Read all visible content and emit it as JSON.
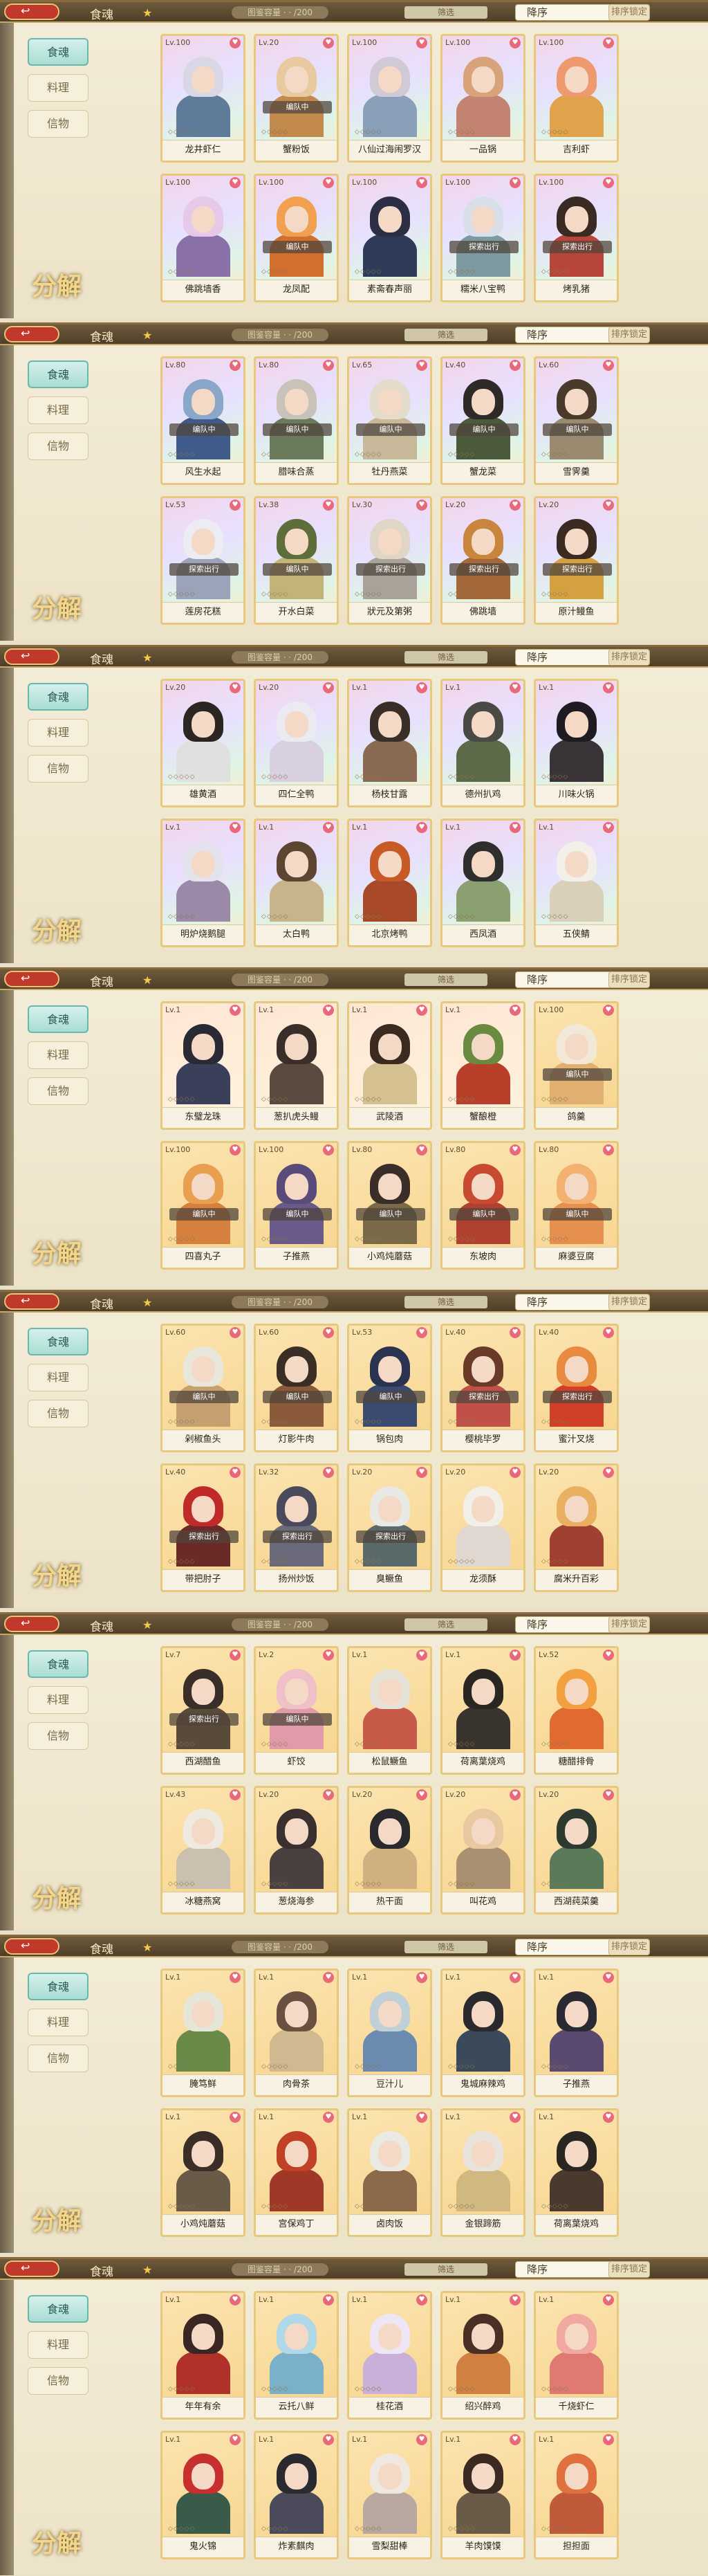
{
  "app": {
    "back_label": "↩",
    "title": "食魂",
    "capacity_text": "图鉴容量 · · /200",
    "filter_label": "筛选",
    "sort_label": "降序",
    "sort_lock_label": "排序锁定",
    "tabs": [
      "食魂",
      "料理",
      "信物"
    ],
    "decompose_label": "分解"
  },
  "status_labels": {
    "team": "编队中",
    "explore": "探索出行"
  },
  "icons": {
    "back": "back-arrow-icon",
    "heart": "heart-icon",
    "star": "star-icon"
  },
  "panels": [
    {
      "cards": [
        {
          "lv": "Lv.100",
          "name": "龙井虾仁",
          "status": "",
          "rarity": "ssr",
          "hair": "#d9d7e6",
          "outfit": "#5e7b9a"
        },
        {
          "lv": "Lv.20",
          "name": "蟹粉饭",
          "status": "team",
          "rarity": "ssr",
          "hair": "#e8c9a0",
          "outfit": "#c28a4c"
        },
        {
          "lv": "Lv.100",
          "name": "八仙过海闹罗汉",
          "status": "",
          "rarity": "ssr",
          "hair": "#cfcad6",
          "outfit": "#8aa0b8"
        },
        {
          "lv": "Lv.100",
          "name": "一品锅",
          "status": "",
          "rarity": "ssr",
          "hair": "#d9a37a",
          "outfit": "#c28470"
        },
        {
          "lv": "Lv.100",
          "name": "吉利虾",
          "status": "",
          "rarity": "ssr",
          "hair": "#ef9a6e",
          "outfit": "#e0a24a"
        },
        {
          "lv": "Lv.100",
          "name": "佛跳墙香",
          "status": "",
          "rarity": "ssr",
          "hair": "#e6c8e8",
          "outfit": "#8a70a8"
        },
        {
          "lv": "Lv.100",
          "name": "龙凤配",
          "status": "team",
          "rarity": "ssr",
          "hair": "#f1a050",
          "outfit": "#d36f2e"
        },
        {
          "lv": "Lv.100",
          "name": "素斋春声丽",
          "status": "",
          "rarity": "ssr",
          "hair": "#2c2f44",
          "outfit": "#2e3b58"
        },
        {
          "lv": "Lv.100",
          "name": "糯米八宝鸭",
          "status": "explore",
          "rarity": "ssr",
          "hair": "#d9dfe8",
          "outfit": "#7d9aa0"
        },
        {
          "lv": "Lv.100",
          "name": "烤乳猪",
          "status": "explore",
          "rarity": "ssr",
          "hair": "#3a2a24",
          "outfit": "#b8453a"
        }
      ]
    },
    {
      "cards": [
        {
          "lv": "Lv.80",
          "name": "风生水起",
          "status": "team",
          "rarity": "ssr",
          "hair": "#8aa6c8",
          "outfit": "#3f5b8a"
        },
        {
          "lv": "Lv.80",
          "name": "腊味合蒸",
          "status": "team",
          "rarity": "ssr",
          "hair": "#c9c2b8",
          "outfit": "#6a7a5c"
        },
        {
          "lv": "Lv.65",
          "name": "牡丹燕菜",
          "status": "team",
          "rarity": "ssr",
          "hair": "#e4dccb",
          "outfit": "#c8b89a"
        },
        {
          "lv": "Lv.40",
          "name": "蟹龙菜",
          "status": "team",
          "rarity": "ssr",
          "hair": "#2e2a28",
          "outfit": "#4a5a3a"
        },
        {
          "lv": "Lv.60",
          "name": "雪霁羹",
          "status": "team",
          "rarity": "ssr",
          "hair": "#4a3a2c",
          "outfit": "#9a8a70"
        },
        {
          "lv": "Lv.53",
          "name": "莲房花糕",
          "status": "explore",
          "rarity": "ssr",
          "hair": "#ececf2",
          "outfit": "#9aa3ba"
        },
        {
          "lv": "Lv.38",
          "name": "开水白菜",
          "status": "team",
          "rarity": "ssr",
          "hair": "#5e6e3a",
          "outfit": "#c2b478"
        },
        {
          "lv": "Lv.30",
          "name": "狀元及第粥",
          "status": "explore",
          "rarity": "ssr",
          "hair": "#e0d6c8",
          "outfit": "#a8a298"
        },
        {
          "lv": "Lv.20",
          "name": "佛跳墙",
          "status": "explore",
          "rarity": "ssr",
          "hair": "#c9853c",
          "outfit": "#a4683a"
        },
        {
          "lv": "Lv.20",
          "name": "原汁鳗鱼",
          "status": "explore",
          "rarity": "ssr",
          "hair": "#3a2a20",
          "outfit": "#d4a040"
        }
      ]
    },
    {
      "cards": [
        {
          "lv": "Lv.20",
          "name": "雄黄酒",
          "status": "",
          "rarity": "ssr",
          "hair": "#2c2622",
          "outfit": "#e0e0e0"
        },
        {
          "lv": "Lv.20",
          "name": "四仁全鸭",
          "status": "",
          "rarity": "ssr",
          "hair": "#eaeaf0",
          "outfit": "#d8d0e0"
        },
        {
          "lv": "Lv.1",
          "name": "杨枝甘露",
          "status": "",
          "rarity": "ssr",
          "hair": "#3a2e28",
          "outfit": "#8a6a52"
        },
        {
          "lv": "Lv.1",
          "name": "德州扒鸡",
          "status": "",
          "rarity": "ssr",
          "hair": "#4a4a44",
          "outfit": "#5c6a4a"
        },
        {
          "lv": "Lv.1",
          "name": "川味火锅",
          "status": "",
          "rarity": "ssr",
          "hair": "#1e1c22",
          "outfit": "#3a3438"
        },
        {
          "lv": "Lv.1",
          "name": "明炉烧鹅腿",
          "status": "",
          "rarity": "ssr",
          "hair": "#e4e2ec",
          "outfit": "#9a8aa8"
        },
        {
          "lv": "Lv.1",
          "name": "太白鸭",
          "status": "",
          "rarity": "ssr",
          "hair": "#5c4632",
          "outfit": "#c8b48a"
        },
        {
          "lv": "Lv.1",
          "name": "北京烤鸭",
          "status": "",
          "rarity": "ssr",
          "hair": "#c85a28",
          "outfit": "#a84a2a"
        },
        {
          "lv": "Lv.1",
          "name": "西凤酒",
          "status": "",
          "rarity": "ssr",
          "hair": "#2e2e2c",
          "outfit": "#8aa070"
        },
        {
          "lv": "Lv.1",
          "name": "五侠鲭",
          "status": "",
          "rarity": "ssr",
          "hair": "#f2f0e8",
          "outfit": "#d8d0b8"
        }
      ]
    },
    {
      "cards": [
        {
          "lv": "Lv.1",
          "name": "东璧龙珠",
          "status": "",
          "rarity": "sr",
          "hair": "#2a2a34",
          "outfit": "#3a3f5a"
        },
        {
          "lv": "Lv.1",
          "name": "葱扒虎头鳗",
          "status": "",
          "rarity": "sr",
          "hair": "#3a2e2a",
          "outfit": "#5a4a40"
        },
        {
          "lv": "Lv.1",
          "name": "武陵酒",
          "status": "",
          "rarity": "sr",
          "hair": "#3a2a20",
          "outfit": "#d4c090"
        },
        {
          "lv": "Lv.1",
          "name": "蟹酿橙",
          "status": "",
          "rarity": "sr",
          "hair": "#6a8a40",
          "outfit": "#b8402a"
        },
        {
          "lv": "Lv.100",
          "name": "鸽羹",
          "status": "team",
          "rarity": "r",
          "hair": "#f2e8d8",
          "outfit": "#e0b070"
        },
        {
          "lv": "Lv.100",
          "name": "四喜丸子",
          "status": "team",
          "rarity": "r",
          "hair": "#e8a050",
          "outfit": "#d68040"
        },
        {
          "lv": "Lv.100",
          "name": "子推燕",
          "status": "team",
          "rarity": "r",
          "hair": "#5a4c7a",
          "outfit": "#6a5a8a"
        },
        {
          "lv": "Lv.80",
          "name": "小鸡炖蘑菇",
          "status": "team",
          "rarity": "r",
          "hair": "#3a2e28",
          "outfit": "#7a6a4a"
        },
        {
          "lv": "Lv.80",
          "name": "东坡肉",
          "status": "team",
          "rarity": "r",
          "hair": "#c84a30",
          "outfit": "#b04030"
        },
        {
          "lv": "Lv.80",
          "name": "麻婆豆腐",
          "status": "team",
          "rarity": "r",
          "hair": "#f4b070",
          "outfit": "#e69050"
        }
      ]
    },
    {
      "cards": [
        {
          "lv": "Lv.60",
          "name": "剁椒鱼头",
          "status": "team",
          "rarity": "r",
          "hair": "#e9e6dc",
          "outfit": "#c6a070"
        },
        {
          "lv": "Lv.60",
          "name": "灯影牛肉",
          "status": "team",
          "rarity": "r",
          "hair": "#3a2e26",
          "outfit": "#8a5a3a"
        },
        {
          "lv": "Lv.53",
          "name": "锅包肉",
          "status": "team",
          "rarity": "r",
          "hair": "#2a3450",
          "outfit": "#3a4a70"
        },
        {
          "lv": "Lv.40",
          "name": "樱桃毕罗",
          "status": "explore",
          "rarity": "r",
          "hair": "#6a3a28",
          "outfit": "#c05048"
        },
        {
          "lv": "Lv.40",
          "name": "蜜汁叉烧",
          "status": "explore",
          "rarity": "r",
          "hair": "#e88a40",
          "outfit": "#d04028"
        },
        {
          "lv": "Lv.40",
          "name": "带把肘子",
          "status": "explore",
          "rarity": "r",
          "hair": "#c02a28",
          "outfit": "#6a2a28"
        },
        {
          "lv": "Lv.32",
          "name": "扬州炒饭",
          "status": "explore",
          "rarity": "r",
          "hair": "#4a4a5c",
          "outfit": "#6a6a7a"
        },
        {
          "lv": "Lv.20",
          "name": "臭鳜鱼",
          "status": "explore",
          "rarity": "r",
          "hair": "#e8e8e4",
          "outfit": "#5a6a6a"
        },
        {
          "lv": "Lv.20",
          "name": "龙须酥",
          "status": "",
          "rarity": "r",
          "hair": "#f2eee8",
          "outfit": "#e0d8d0"
        },
        {
          "lv": "Lv.20",
          "name": "腐米升百彩",
          "status": "",
          "rarity": "r",
          "hair": "#e8b060",
          "outfit": "#a04030"
        }
      ]
    },
    {
      "cards": [
        {
          "lv": "Lv.7",
          "name": "西湖醋鱼",
          "status": "explore",
          "rarity": "r",
          "hair": "#3a2e28",
          "outfit": "#5a4a3a"
        },
        {
          "lv": "Lv.2",
          "name": "虾饺",
          "status": "team",
          "rarity": "r",
          "hair": "#f0c0c8",
          "outfit": "#e09aa8"
        },
        {
          "lv": "Lv.1",
          "name": "松鼠鳜鱼",
          "status": "",
          "rarity": "r",
          "hair": "#e6e2d8",
          "outfit": "#c85a4a"
        },
        {
          "lv": "Lv.1",
          "name": "荷离葉烧鸡",
          "status": "",
          "rarity": "r",
          "hair": "#2a2622",
          "outfit": "#3a342e"
        },
        {
          "lv": "Lv.52",
          "name": "糖醋排骨",
          "status": "",
          "rarity": "r",
          "hair": "#f2a040",
          "outfit": "#e06a30"
        },
        {
          "lv": "Lv.43",
          "name": "冰糖燕窝",
          "status": "",
          "rarity": "r",
          "hair": "#efeae0",
          "outfit": "#cac0b0"
        },
        {
          "lv": "Lv.20",
          "name": "葱烧海参",
          "status": "",
          "rarity": "r",
          "hair": "#3a3030",
          "outfit": "#4a4040"
        },
        {
          "lv": "Lv.20",
          "name": "热干面",
          "status": "",
          "rarity": "r",
          "hair": "#2a2a2e",
          "outfit": "#d0b080"
        },
        {
          "lv": "Lv.20",
          "name": "叫花鸡",
          "status": "",
          "rarity": "r",
          "hair": "#e8c8a0",
          "outfit": "#a89070"
        },
        {
          "lv": "Lv.20",
          "name": "西湖莼菜羹",
          "status": "",
          "rarity": "r",
          "hair": "#2e3a30",
          "outfit": "#5a7a5a"
        }
      ]
    },
    {
      "cards": [
        {
          "lv": "Lv.1",
          "name": "腌笃鲜",
          "status": "",
          "rarity": "r",
          "hair": "#e6e6d8",
          "outfit": "#6a8a4a"
        },
        {
          "lv": "Lv.1",
          "name": "肉骨茶",
          "status": "",
          "rarity": "r",
          "hair": "#6a5040",
          "outfit": "#d0b890"
        },
        {
          "lv": "Lv.1",
          "name": "豆汁儿",
          "status": "",
          "rarity": "r",
          "hair": "#c0d0d8",
          "outfit": "#6a8ab0"
        },
        {
          "lv": "Lv.1",
          "name": "鬼城麻辣鸡",
          "status": "",
          "rarity": "r",
          "hair": "#2a2a2e",
          "outfit": "#3a4a5a"
        },
        {
          "lv": "Lv.1",
          "name": "子推燕",
          "status": "",
          "rarity": "r",
          "hair": "#2a2a34",
          "outfit": "#5a4a70"
        },
        {
          "lv": "Lv.1",
          "name": "小鸡炖蘑菇",
          "status": "",
          "rarity": "r",
          "hair": "#3a2e26",
          "outfit": "#6a5a48"
        },
        {
          "lv": "Lv.1",
          "name": "宫保鸡丁",
          "status": "",
          "rarity": "r",
          "hair": "#c04028",
          "outfit": "#a03828"
        },
        {
          "lv": "Lv.1",
          "name": "卤肉饭",
          "status": "",
          "rarity": "r",
          "hair": "#eaeae4",
          "outfit": "#8a6a4a"
        },
        {
          "lv": "Lv.1",
          "name": "金银蹄筋",
          "status": "",
          "rarity": "r",
          "hair": "#e8e4dc",
          "outfit": "#d0b880"
        },
        {
          "lv": "Lv.1",
          "name": "荷离葉烧鸡",
          "status": "",
          "rarity": "r",
          "hair": "#2a2622",
          "outfit": "#4a3a2e"
        }
      ]
    },
    {
      "cards": [
        {
          "lv": "Lv.1",
          "name": "年年有余",
          "status": "",
          "rarity": "r",
          "hair": "#3a2622",
          "outfit": "#b0302a"
        },
        {
          "lv": "Lv.1",
          "name": "云托八鲜",
          "status": "",
          "rarity": "r",
          "hair": "#b0d8e8",
          "outfit": "#7ab0c8"
        },
        {
          "lv": "Lv.1",
          "name": "桂花酒",
          "status": "",
          "rarity": "r",
          "hair": "#eee6f4",
          "outfit": "#c8b0d8"
        },
        {
          "lv": "Lv.1",
          "name": "绍兴醉鸡",
          "status": "",
          "rarity": "r",
          "hair": "#4a3024",
          "outfit": "#d08040"
        },
        {
          "lv": "Lv.1",
          "name": "千烧虾仁",
          "status": "",
          "rarity": "r",
          "hair": "#f0a8a0",
          "outfit": "#e07a70"
        },
        {
          "lv": "Lv.1",
          "name": "鬼火锦",
          "status": "",
          "rarity": "r",
          "hair": "#c83030",
          "outfit": "#3a5a4a"
        },
        {
          "lv": "Lv.1",
          "name": "炸素麒肉",
          "status": "",
          "rarity": "r",
          "hair": "#2a2a30",
          "outfit": "#4a4a5a"
        },
        {
          "lv": "Lv.1",
          "name": "雪梨甜棒",
          "status": "",
          "rarity": "r",
          "hair": "#eee8e0",
          "outfit": "#b8a8a0"
        },
        {
          "lv": "Lv.1",
          "name": "羊肉馍馍",
          "status": "",
          "rarity": "r",
          "hair": "#3a2a22",
          "outfit": "#6a5a48"
        },
        {
          "lv": "Lv.1",
          "name": "担担面",
          "status": "",
          "rarity": "r",
          "hair": "#e07040",
          "outfit": "#c05a3a"
        }
      ]
    }
  ]
}
